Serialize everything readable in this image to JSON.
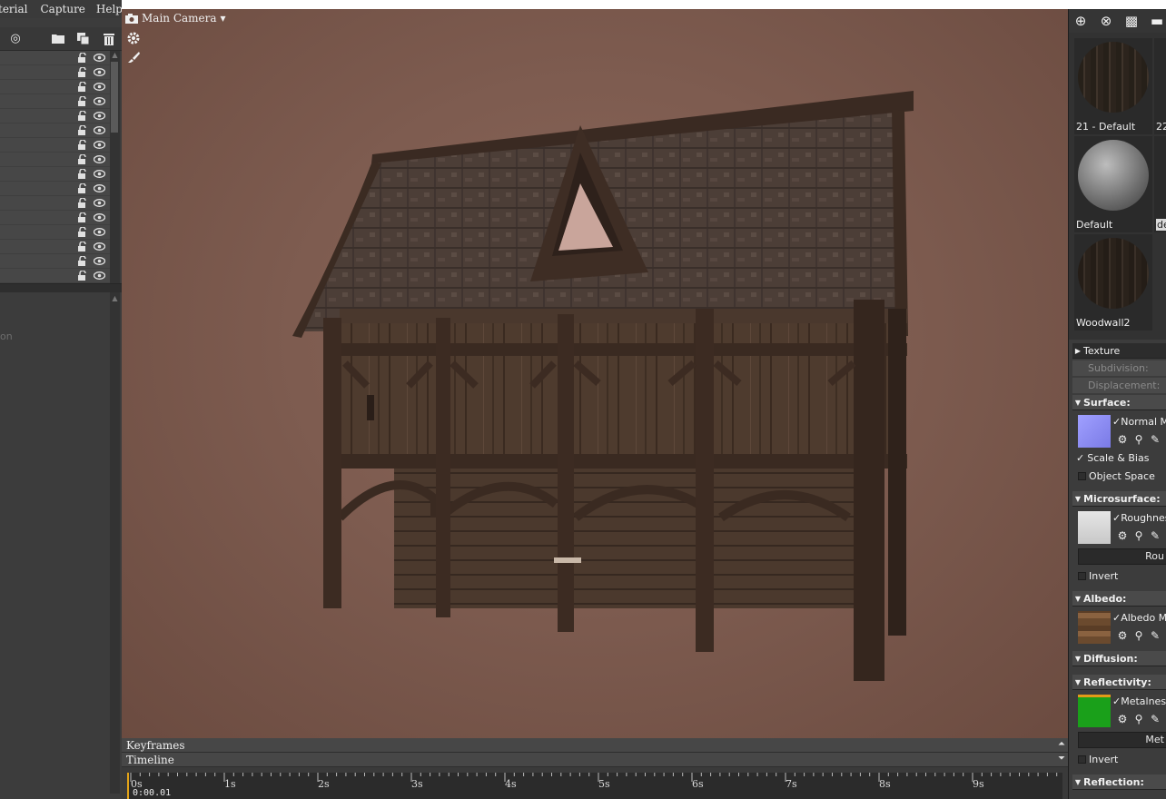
{
  "menubar": {
    "items": [
      "terial",
      "Capture",
      "Help"
    ]
  },
  "viewport": {
    "camera_label": "Main Camera",
    "camera_dropdown": "▾"
  },
  "left_props": {
    "faint_text": "on"
  },
  "bottom": {
    "keyframes_label": "Keyframes",
    "timeline_label": "Timeline",
    "ticks": [
      "0s",
      "1s",
      "2s",
      "3s",
      "4s",
      "5s",
      "6s",
      "7s",
      "8s",
      "9s"
    ],
    "time_readout": "0:00.01"
  },
  "materials": {
    "items": [
      {
        "label": "21 - Default",
        "style": "wood"
      },
      {
        "label": "Default",
        "style": "gray"
      },
      {
        "label": "Woodwall2",
        "style": "wood"
      }
    ],
    "peek_labels": [
      "22",
      "de"
    ]
  },
  "sections": {
    "texture": "Texture",
    "subdivision": "Subdivision:",
    "displacement": "Displacement:",
    "surface": "Surface:",
    "surface_map": "Normal M",
    "scale_bias": "Scale & Bias",
    "object_space": "Object Space",
    "microsurface": "Microsurface:",
    "micro_map": "Roughness",
    "micro_field": "Rou",
    "invert1": "Invert",
    "albedo": "Albedo:",
    "albedo_map": "Albedo M",
    "diffusion": "Diffusion:",
    "reflectivity": "Reflectivity:",
    "reflect_map": "Metalness",
    "reflect_field": "Met",
    "invert2": "Invert",
    "reflection": "Reflection:"
  },
  "colors": {
    "viewport_bg": "#7e5c50",
    "playhead": "#e2a318",
    "metalness_swatch": "#1aa01a",
    "normal_swatch": "#8c8cf0"
  }
}
